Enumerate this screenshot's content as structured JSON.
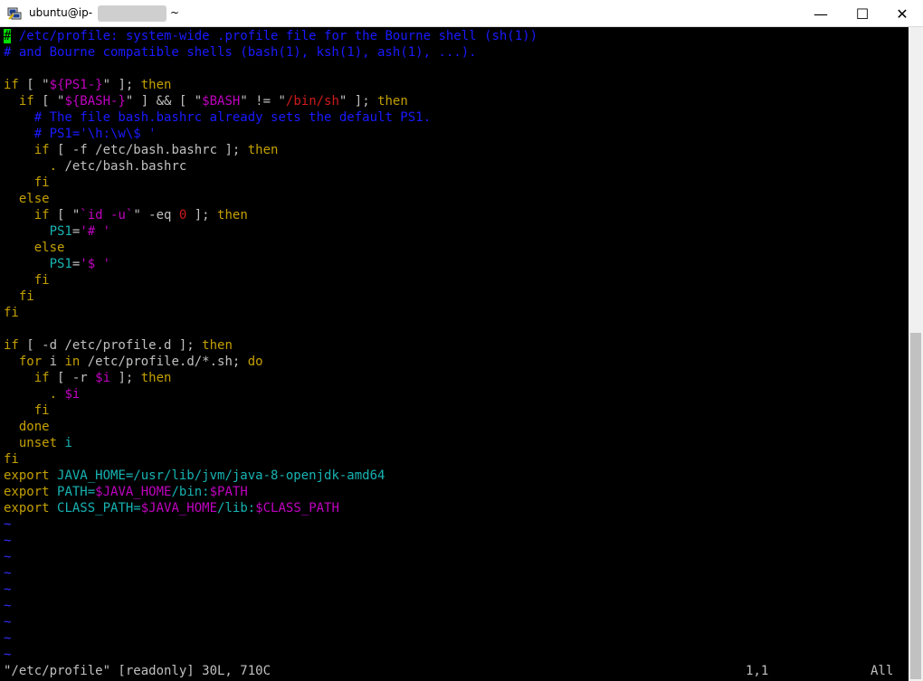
{
  "window": {
    "title_prefix": "ubuntu@ip-",
    "title_suffix": "~",
    "minimize_glyph": "—",
    "maximize_glyph": "☐",
    "close_glyph": "✕"
  },
  "colors": {
    "comment": "#1a1aff",
    "keyword": "#c4a000",
    "special": "#c000c0",
    "string": "#d01a1a",
    "identifier": "#17b3b3",
    "cursor": "#00e000",
    "background": "#000000"
  },
  "lines": [
    [
      [
        "c",
        "# /etc/profile: system-wide .profile file for the Bourne shell (sh(1))"
      ]
    ],
    [
      [
        "c",
        "# and Bourne compatible shells (bash(1), ksh(1), ash(1), ...)."
      ]
    ],
    [
      [
        "n",
        ""
      ]
    ],
    [
      [
        "kw",
        "if"
      ],
      [
        "n",
        " [ \""
      ],
      [
        "pp",
        "${PS1-}"
      ],
      [
        "n",
        "\" ]; "
      ],
      [
        "kw",
        "then"
      ]
    ],
    [
      [
        "n",
        "  "
      ],
      [
        "kw",
        "if"
      ],
      [
        "n",
        " [ \""
      ],
      [
        "pp",
        "${BASH-}"
      ],
      [
        "n",
        "\" ] && [ \""
      ],
      [
        "pp",
        "$BASH"
      ],
      [
        "n",
        "\" != \""
      ],
      [
        "st",
        "/bin/sh"
      ],
      [
        "n",
        "\" ]; "
      ],
      [
        "kw",
        "then"
      ]
    ],
    [
      [
        "n",
        "    "
      ],
      [
        "c",
        "# The file bash.bashrc already sets the default PS1."
      ]
    ],
    [
      [
        "n",
        "    "
      ],
      [
        "c",
        "# PS1='\\h:\\w\\$ '"
      ]
    ],
    [
      [
        "n",
        "    "
      ],
      [
        "kw",
        "if"
      ],
      [
        "n",
        " [ -f /etc/bash.bashrc ]; "
      ],
      [
        "kw",
        "then"
      ]
    ],
    [
      [
        "n",
        "      "
      ],
      [
        "kw",
        "."
      ],
      [
        "n",
        " /etc/bash.bashrc"
      ]
    ],
    [
      [
        "n",
        "    "
      ],
      [
        "kw",
        "fi"
      ]
    ],
    [
      [
        "n",
        "  "
      ],
      [
        "kw",
        "else"
      ]
    ],
    [
      [
        "n",
        "    "
      ],
      [
        "kw",
        "if"
      ],
      [
        "n",
        " [ \""
      ],
      [
        "pp",
        "`id -u`"
      ],
      [
        "n",
        "\" -eq "
      ],
      [
        "st",
        "0"
      ],
      [
        "n",
        " ]; "
      ],
      [
        "kw",
        "then"
      ]
    ],
    [
      [
        "n",
        "      "
      ],
      [
        "id",
        "PS1"
      ],
      [
        "n",
        "="
      ],
      [
        "pp",
        "'# '"
      ]
    ],
    [
      [
        "n",
        "    "
      ],
      [
        "kw",
        "else"
      ]
    ],
    [
      [
        "n",
        "      "
      ],
      [
        "id",
        "PS1"
      ],
      [
        "n",
        "="
      ],
      [
        "pp",
        "'$ '"
      ]
    ],
    [
      [
        "n",
        "    "
      ],
      [
        "kw",
        "fi"
      ]
    ],
    [
      [
        "n",
        "  "
      ],
      [
        "kw",
        "fi"
      ]
    ],
    [
      [
        "kw",
        "fi"
      ]
    ],
    [
      [
        "n",
        ""
      ]
    ],
    [
      [
        "kw",
        "if"
      ],
      [
        "n",
        " [ -d /etc/profile.d ]; "
      ],
      [
        "kw",
        "then"
      ]
    ],
    [
      [
        "n",
        "  "
      ],
      [
        "kw",
        "for"
      ],
      [
        "n",
        " i "
      ],
      [
        "kw",
        "in"
      ],
      [
        "n",
        " /etc/profile.d/*.sh; "
      ],
      [
        "kw",
        "do"
      ]
    ],
    [
      [
        "n",
        "    "
      ],
      [
        "kw",
        "if"
      ],
      [
        "n",
        " [ -r "
      ],
      [
        "pp",
        "$i"
      ],
      [
        "n",
        " ]; "
      ],
      [
        "kw",
        "then"
      ]
    ],
    [
      [
        "n",
        "      "
      ],
      [
        "kw",
        "."
      ],
      [
        "n",
        " "
      ],
      [
        "pp",
        "$i"
      ]
    ],
    [
      [
        "n",
        "    "
      ],
      [
        "kw",
        "fi"
      ]
    ],
    [
      [
        "n",
        "  "
      ],
      [
        "kw",
        "done"
      ]
    ],
    [
      [
        "n",
        "  "
      ],
      [
        "kw",
        "unset"
      ],
      [
        "n",
        " "
      ],
      [
        "id",
        "i"
      ]
    ],
    [
      [
        "kw",
        "fi"
      ]
    ],
    [
      [
        "kw",
        "export"
      ],
      [
        "n",
        " "
      ],
      [
        "id",
        "JAVA_HOME=/usr/lib/jvm/java-8-openjdk-amd64"
      ]
    ],
    [
      [
        "kw",
        "export"
      ],
      [
        "n",
        " "
      ],
      [
        "id",
        "PATH="
      ],
      [
        "pp",
        "$JAVA_HOME"
      ],
      [
        "id",
        "/bin:"
      ],
      [
        "pp",
        "$PATH"
      ]
    ],
    [
      [
        "kw",
        "export"
      ],
      [
        "n",
        " "
      ],
      [
        "id",
        "CLASS_PATH="
      ],
      [
        "pp",
        "$JAVA_HOME"
      ],
      [
        "id",
        "/lib:"
      ],
      [
        "pp",
        "$CLASS_PATH"
      ]
    ],
    [
      [
        "tl",
        "~"
      ]
    ],
    [
      [
        "tl",
        "~"
      ]
    ],
    [
      [
        "tl",
        "~"
      ]
    ],
    [
      [
        "tl",
        "~"
      ]
    ],
    [
      [
        "tl",
        "~"
      ]
    ],
    [
      [
        "tl",
        "~"
      ]
    ],
    [
      [
        "tl",
        "~"
      ]
    ],
    [
      [
        "tl",
        "~"
      ]
    ],
    [
      [
        "tl",
        "~"
      ]
    ]
  ],
  "status": {
    "message": "\"/etc/profile\" [readonly] 30L, 710C",
    "position": "1,1",
    "percent": "All"
  }
}
